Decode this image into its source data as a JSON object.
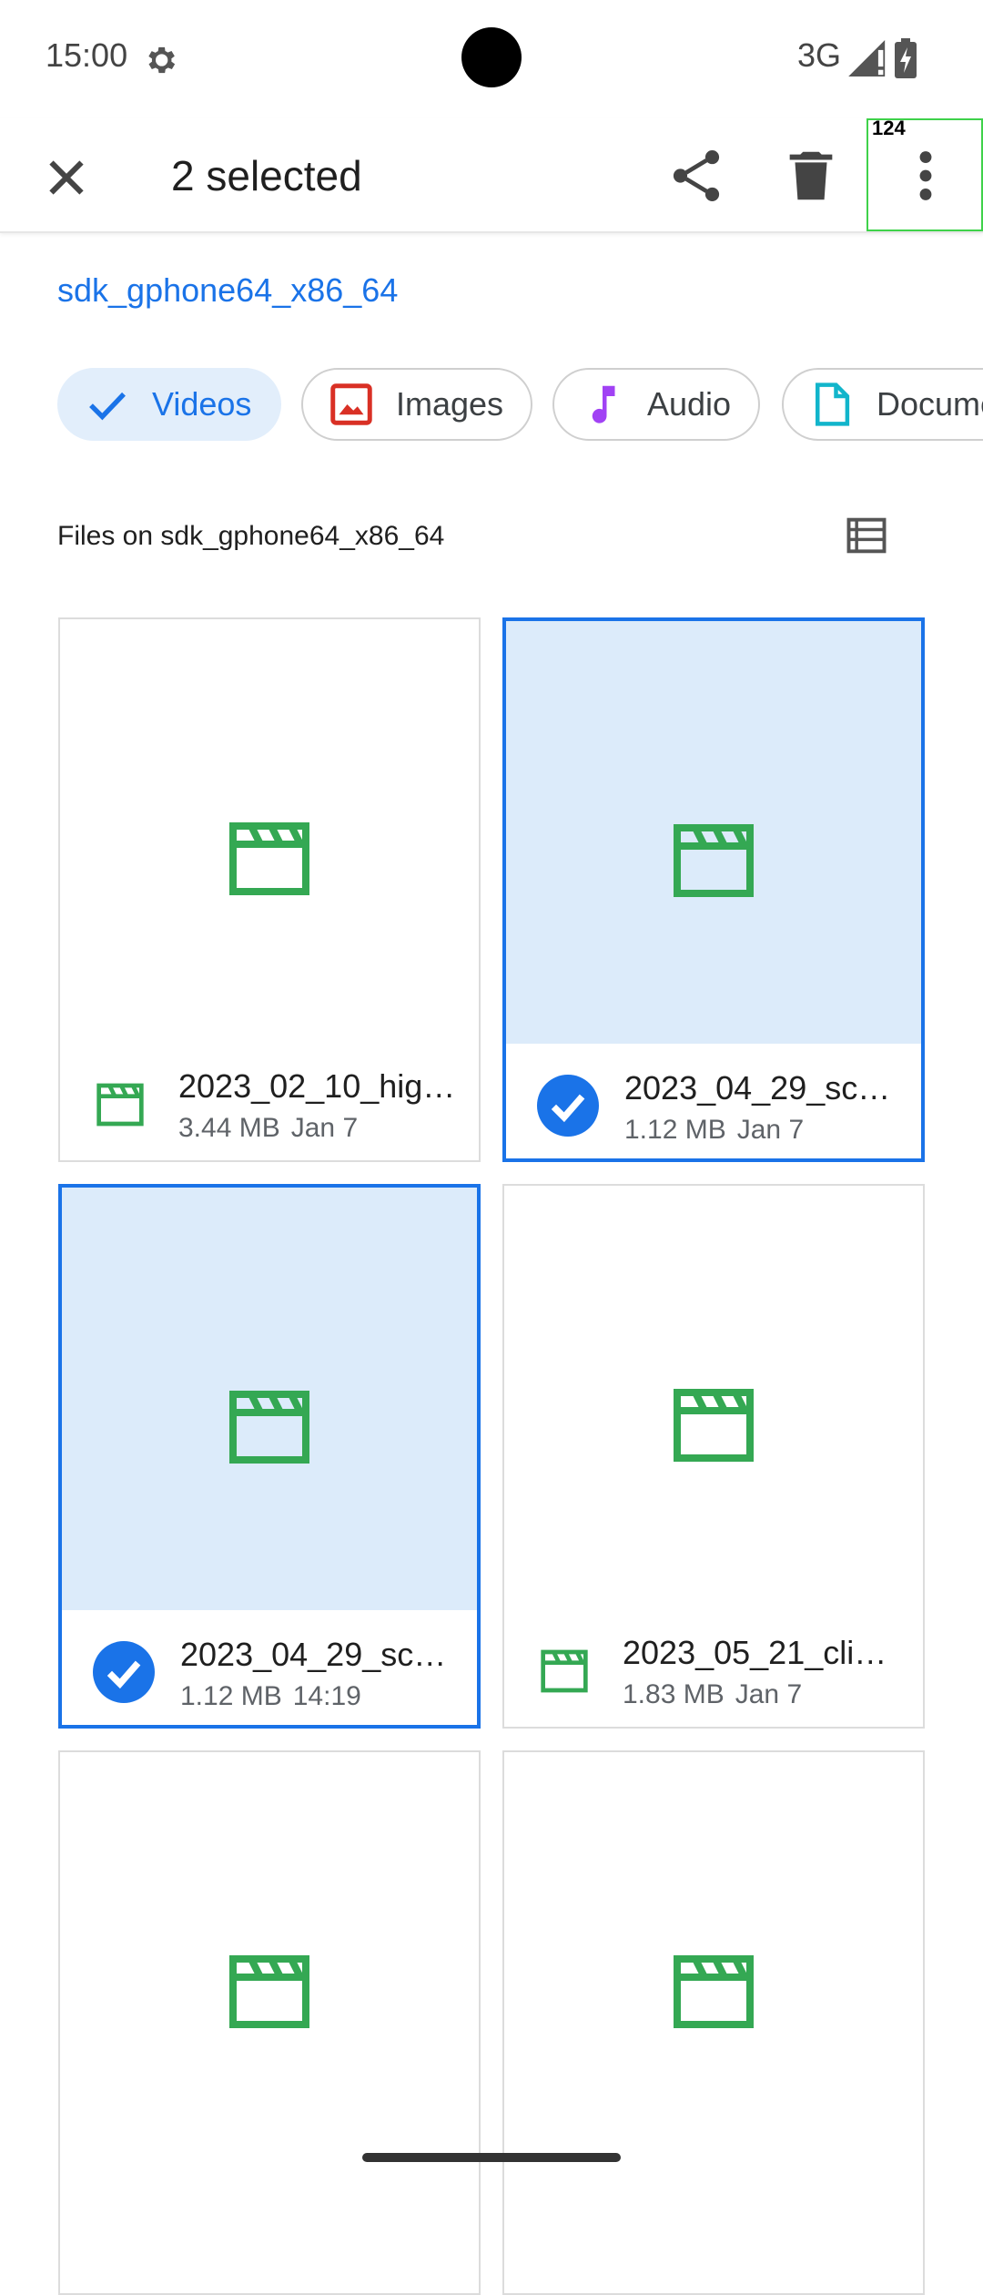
{
  "status_bar": {
    "time": "15:00",
    "network": "3G"
  },
  "action_bar": {
    "title": "2 selected",
    "overlay_badge": "124"
  },
  "breadcrumb": "sdk_gphone64_x86_64",
  "chips": [
    {
      "label": "Videos",
      "icon": "check-icon",
      "active": true
    },
    {
      "label": "Images",
      "icon": "image-icon",
      "color": "#d93025"
    },
    {
      "label": "Audio",
      "icon": "music-note-icon",
      "color": "#a142f4"
    },
    {
      "label": "Documents",
      "icon": "document-icon",
      "color": "#12b5cb"
    }
  ],
  "section": {
    "title": "Files on sdk_gphone64_x86_64"
  },
  "files": [
    {
      "name": "2023_02_10_hig…",
      "size": "3.44 MB",
      "date": "Jan 7",
      "selected": false
    },
    {
      "name": "2023_04_29_sc…",
      "size": "1.12 MB",
      "date": "Jan 7",
      "selected": true
    },
    {
      "name": "2023_04_29_sc…",
      "size": "1.12 MB",
      "date": "14:19",
      "selected": true
    },
    {
      "name": "2023_05_21_cli…",
      "size": "1.83 MB",
      "date": "Jan 7",
      "selected": false
    },
    {
      "name": "",
      "size": "",
      "date": "",
      "selected": false
    },
    {
      "name": "",
      "size": "",
      "date": "",
      "selected": false
    }
  ],
  "colors": {
    "accent": "#1a73e8",
    "video_icon": "#34a853",
    "selected_bg": "#dcebfa"
  }
}
